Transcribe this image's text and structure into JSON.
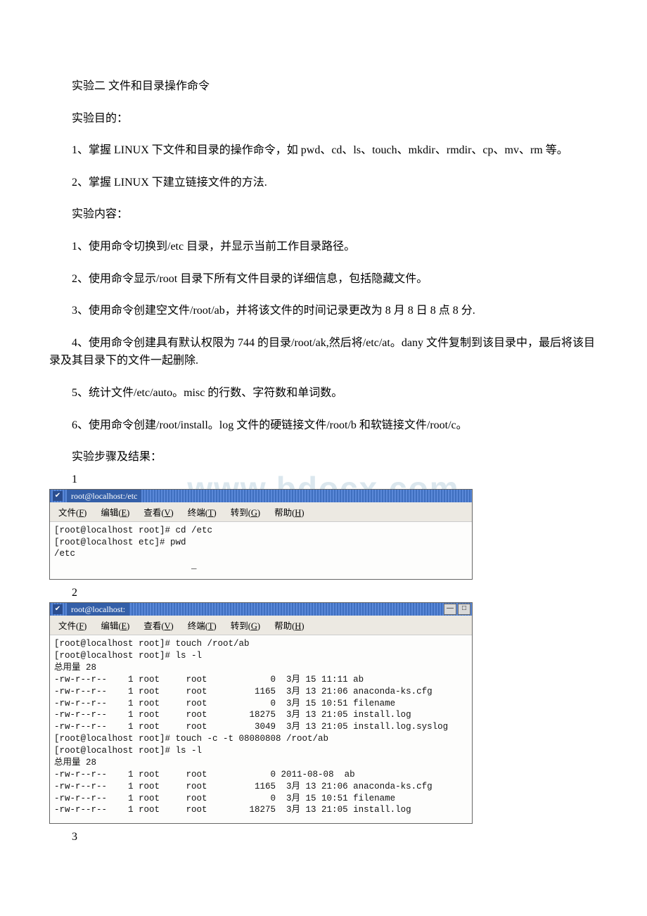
{
  "title": "实验二 文件和目录操作命令",
  "section_purpose_label": "实验目的：",
  "purpose": [
    "1、掌握 LINUX 下文件和目录的操作命令，如 pwd、cd、ls、touch、mkdir、rmdir、cp、mv、rm 等。",
    "2、掌握 LINUX 下建立链接文件的方法."
  ],
  "section_content_label": "实验内容：",
  "content_items": [
    "1、使用命令切换到/etc 目录，并显示当前工作目录路径。",
    "2、使用命令显示/root 目录下所有文件目录的详细信息，包括隐藏文件。",
    "3、使用命令创建空文件/root/ab，并将该文件的时间记录更改为 8 月 8 日 8 点 8 分.",
    "4、使用命令创建具有默认权限为 744 的目录/root/ak,然后将/etc/at。dany 文件复制到该目录中，最后将该目录及其目录下的文件一起删除.",
    "5、统计文件/etc/auto。misc 的行数、字符数和单词数。",
    "6、使用命令创建/root/install。log 文件的硬链接文件/root/b 和软链接文件/root/c。"
  ],
  "section_steps_label": "实验步骤及结果：",
  "steps": {
    "one": "1",
    "two": "2",
    "three": "3"
  },
  "watermark": "www.bdocx.com",
  "menu": {
    "file": "文件",
    "file_k": "F",
    "edit": "编辑",
    "edit_k": "E",
    "view": "查看",
    "view_k": "V",
    "term": "终端",
    "term_k": "T",
    "go": "转到",
    "go_k": "G",
    "help": "帮助",
    "help_k": "H"
  },
  "term1": {
    "title_prefix": "root@localhost:",
    "title_path": "/etc",
    "body": "[root@localhost root]# cd /etc\n[root@localhost etc]# pwd\n/etc\n                          _"
  },
  "term2": {
    "title_prefix": "root@localhost:",
    "title_path": "",
    "body": "[root@localhost root]# touch /root/ab\n[root@localhost root]# ls -l\n总用量 28\n-rw-r--r--    1 root     root            0  3月 15 11:11 ab\n-rw-r--r--    1 root     root         1165  3月 13 21:06 anaconda-ks.cfg\n-rw-r--r--    1 root     root            0  3月 15 10:51 filename\n-rw-r--r--    1 root     root        18275  3月 13 21:05 install.log\n-rw-r--r--    1 root     root         3049  3月 13 21:05 install.log.syslog\n[root@localhost root]# touch -c -t 08080808 /root/ab\n[root@localhost root]# ls -l\n总用量 28\n-rw-r--r--    1 root     root            0 2011-08-08  ab\n-rw-r--r--    1 root     root         1165  3月 13 21:06 anaconda-ks.cfg\n-rw-r--r--    1 root     root            0  3月 15 10:51 filename\n-rw-r--r--    1 root     root        18275  3月 13 21:05 install.log"
  },
  "winbtn": {
    "min": "—",
    "max": "□"
  }
}
